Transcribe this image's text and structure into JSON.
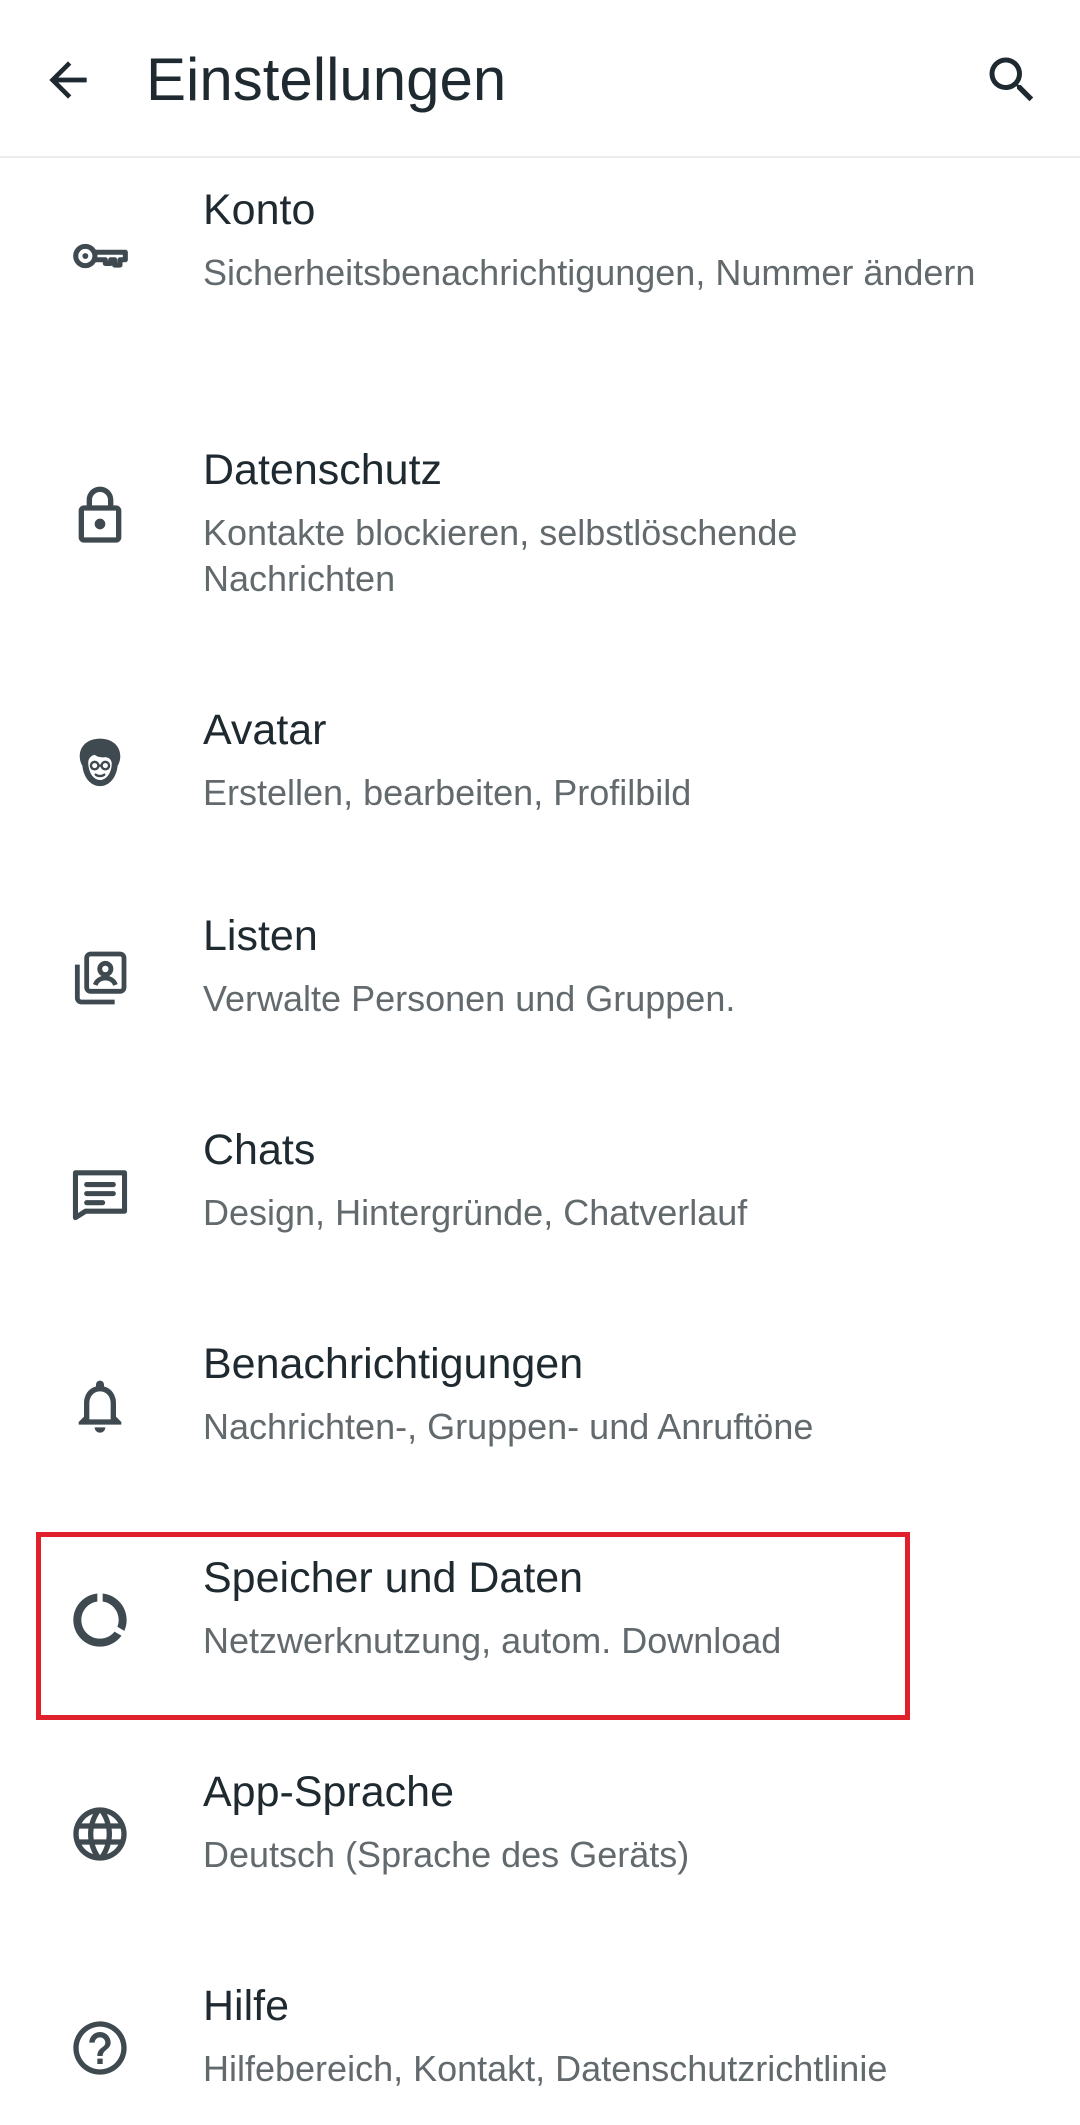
{
  "app_bar": {
    "title": "Einstellungen",
    "back_icon": "arrow-left-icon",
    "search_icon": "search-icon"
  },
  "settings": {
    "items": [
      {
        "id": "konto",
        "title": "Konto",
        "subtitle": "Sicherheitsbenachrichtigungen, Nummer ändern",
        "icon": "key-icon"
      },
      {
        "id": "datenschutz",
        "title": "Datenschutz",
        "subtitle": "Kontakte blockieren, selbstlöschende Nachrichten",
        "icon": "lock-icon"
      },
      {
        "id": "avatar",
        "title": "Avatar",
        "subtitle": "Erstellen, bearbeiten, Profilbild",
        "icon": "avatar-icon"
      },
      {
        "id": "listen",
        "title": "Listen",
        "subtitle": "Verwalte Personen und Gruppen.",
        "icon": "contact-list-icon"
      },
      {
        "id": "chats",
        "title": "Chats",
        "subtitle": "Design, Hintergründe, Chatverlauf",
        "icon": "chat-icon"
      },
      {
        "id": "benachrichtigungen",
        "title": "Benachrichtigungen",
        "subtitle": "Nachrichten-, Gruppen- und Anruftöne",
        "icon": "bell-icon"
      },
      {
        "id": "speicher",
        "title": "Speicher und Daten",
        "subtitle": "Netzwerknutzung, autom. Download",
        "icon": "data-usage-icon"
      },
      {
        "id": "sprache",
        "title": "App-Sprache",
        "subtitle": "Deutsch (Sprache des Geräts)",
        "icon": "globe-icon"
      },
      {
        "id": "hilfe",
        "title": "Hilfe",
        "subtitle": "Hilfebereich, Kontakt, Datenschutzrichtlinie",
        "icon": "help-icon"
      }
    ]
  },
  "colors": {
    "text_primary": "#1f2a30",
    "text_secondary": "#636a6e",
    "icon": "#3f4a50",
    "highlight_border": "#e0202a"
  }
}
